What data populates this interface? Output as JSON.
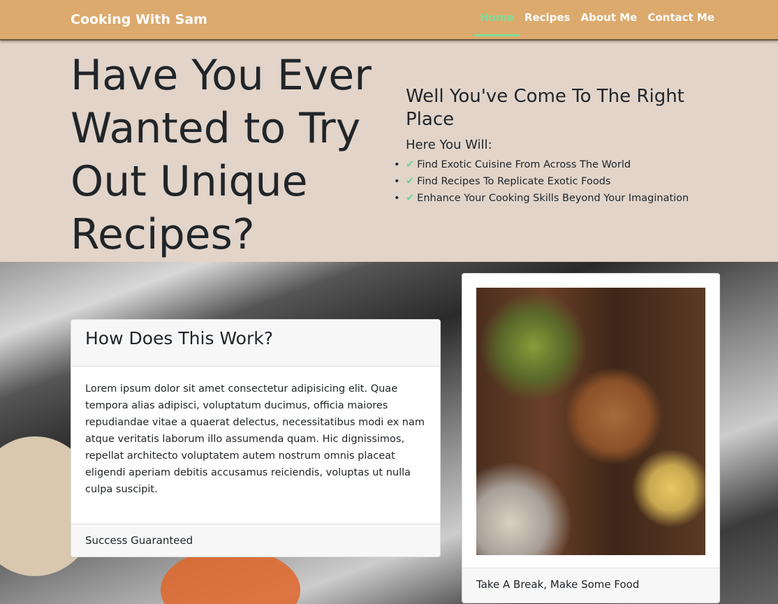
{
  "nav": {
    "brand": "Cooking With Sam",
    "links": [
      "Home",
      "Recipes",
      "About Me",
      "Contact Me"
    ],
    "active": "Home"
  },
  "hero": {
    "title": "Have You Ever Wanted to Try Out Unique Recipes?",
    "subtitle": "Well You've Come To The Right Place",
    "lead": "Here You Will:",
    "items": [
      "Find Exotic Cuisine From Across The World",
      "Find Recipes To Replicate Exotic Foods",
      "Enhance Your Cooking Skills Beyond Your Imagination"
    ],
    "accent": "#7fdc9a"
  },
  "info_card": {
    "header": "How Does This Work?",
    "body": "Lorem ipsum dolor sit amet consectetur adipisicing elit. Quae tempora alias adipisci, voluptatum ducimus, officia maiores repudiandae vitae a quaerat delectus, necessitatibus modi ex nam atque veritatis laborum illo assumenda quam. Hic dignissimos, repellat architecto voluptatem autem nostrum omnis placeat eligendi aperiam debitis accusamus reiciendis, voluptas ut nulla culpa suscipit.",
    "footer": "Success Guaranteed"
  },
  "image_card": {
    "footer": "Take A Break, Make Some Food"
  }
}
